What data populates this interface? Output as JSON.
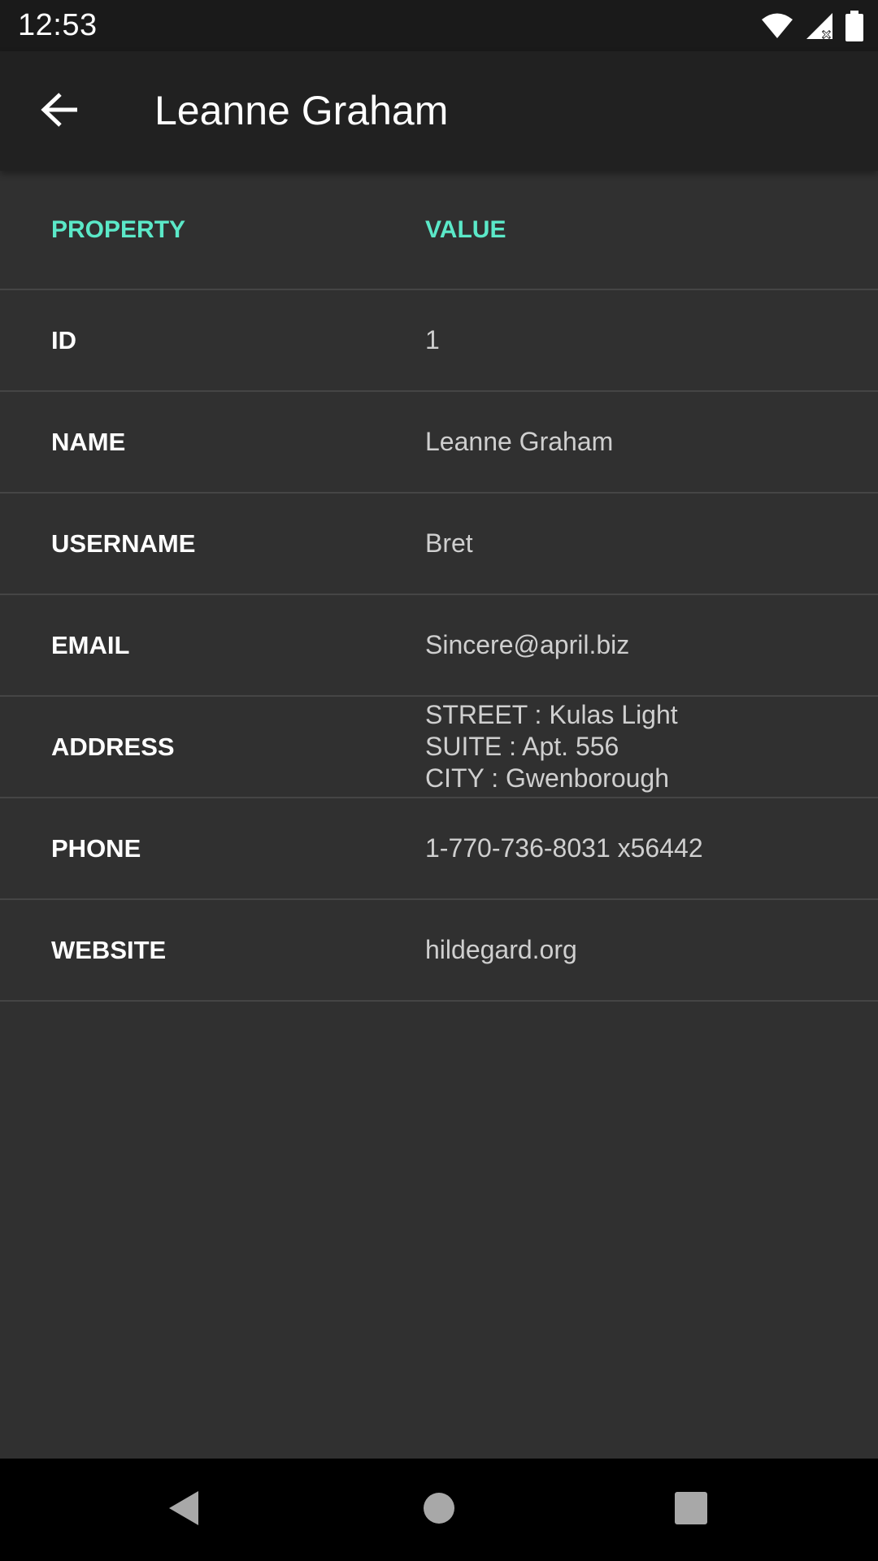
{
  "status_bar": {
    "time": "12:53",
    "icons": [
      "wifi-icon",
      "cellular-signal-icon",
      "battery-icon"
    ]
  },
  "app_bar": {
    "back_icon": "arrow-back-icon",
    "title": "Leanne Graham"
  },
  "table": {
    "headers": {
      "property": "PROPERTY",
      "value": "VALUE"
    },
    "rows": [
      {
        "property": "ID",
        "value": "1"
      },
      {
        "property": "NAME",
        "value": "Leanne Graham"
      },
      {
        "property": "USERNAME",
        "value": "Bret"
      },
      {
        "property": "EMAIL",
        "value": "Sincere@april.biz"
      },
      {
        "property": "ADDRESS",
        "value_lines": [
          "STREET : Kulas Light",
          "SUITE : Apt. 556",
          "CITY : Gwenborough"
        ]
      },
      {
        "property": "PHONE",
        "value": "1-770-736-8031 x56442"
      },
      {
        "property": "WEBSITE",
        "value": "hildegard.org"
      }
    ]
  },
  "nav_bar": {
    "icons": [
      "back-triangle-icon",
      "home-circle-icon",
      "recents-square-icon"
    ]
  },
  "colors": {
    "accent": "#5be8c8",
    "background": "#303030",
    "app_bar": "#212121"
  }
}
